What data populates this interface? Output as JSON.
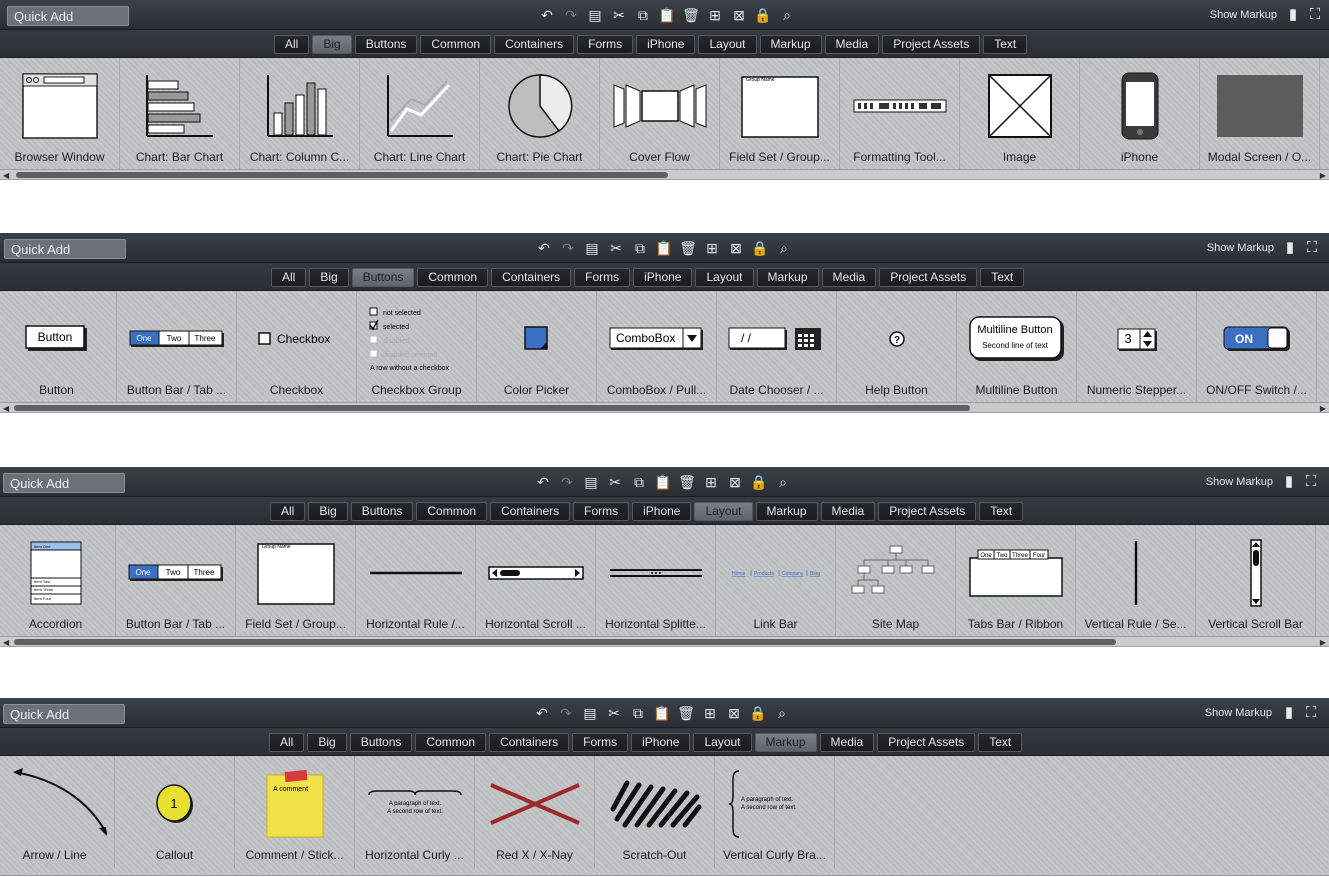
{
  "panels": [
    {
      "quick_add": "Quick Add",
      "show_markup": "Show Markup",
      "active_tab": "Big",
      "items": [
        "Browser Window",
        "Chart: Bar Chart",
        "Chart: Column C...",
        "Chart: Line Chart",
        "Chart: Pie Chart",
        "Cover Flow",
        "Field Set / Group...",
        "Formatting Tool...",
        "Image",
        "iPhone",
        "Modal Screen / O..."
      ]
    },
    {
      "quick_add": "Quick Add",
      "show_markup": "Show Markup",
      "active_tab": "Buttons",
      "items": [
        "Button",
        "Button Bar / Tab ...",
        "Checkbox",
        "Checkbox Group",
        "Color Picker",
        "ComboBox / Pull...",
        "Date Chooser / ...",
        "Help Button",
        "Multiline Button",
        "Numeric Stepper...",
        "ON/OFF Switch /..."
      ]
    },
    {
      "quick_add": "Quick Add",
      "show_markup": "Show Markup",
      "active_tab": "Layout",
      "items": [
        "Accordion",
        "Button Bar / Tab ...",
        "Field Set / Group...",
        "Horizontal Rule /...",
        "Horizontal Scroll ...",
        "Horizontal Splitte...",
        "Link Bar",
        "Site Map",
        "Tabs Bar / Ribbon",
        "Vertical Rule / Se...",
        "Vertical Scroll Bar"
      ]
    },
    {
      "quick_add": "Quick Add",
      "show_markup": "Show Markup",
      "active_tab": "Markup",
      "items": [
        "Arrow / Line",
        "Callout",
        "Comment / Stick...",
        "Horizontal Curly ...",
        "Red X / X-Nay",
        "Scratch-Out",
        "Vertical Curly Bra..."
      ]
    }
  ],
  "tabs": [
    "All",
    "Big",
    "Buttons",
    "Common",
    "Containers",
    "Forms",
    "iPhone",
    "Layout",
    "Markup",
    "Media",
    "Project Assets",
    "Text"
  ],
  "thumb_text": {
    "button": "Button",
    "bar": [
      "One",
      "Two",
      "Three"
    ],
    "checkbox": "Checkbox",
    "cbg": [
      "not selected",
      "selected",
      "disabled",
      "disabled selected",
      "A row without a checkbox"
    ],
    "combo": "ComboBox",
    "date": "/   /",
    "multi1": "Multiline Button",
    "multi2": "Second line of text",
    "stepper": "3",
    "on": "ON",
    "group_name": "Group Name",
    "accordion": [
      "Item One",
      "Item Two",
      "Item Three",
      "Item Four"
    ],
    "linkbar": [
      "Home",
      "Products",
      "Company",
      "Blog"
    ],
    "tabs4": [
      "One",
      "Two",
      "Three",
      "Four"
    ],
    "comment": "A comment",
    "callout": "1",
    "para1": "A paragraph of text.",
    "para2": "A second row of text."
  },
  "colors": {
    "accent": "#3a6fc4",
    "red_x": "#9b2a2f",
    "sticky": "#f4e24a"
  }
}
